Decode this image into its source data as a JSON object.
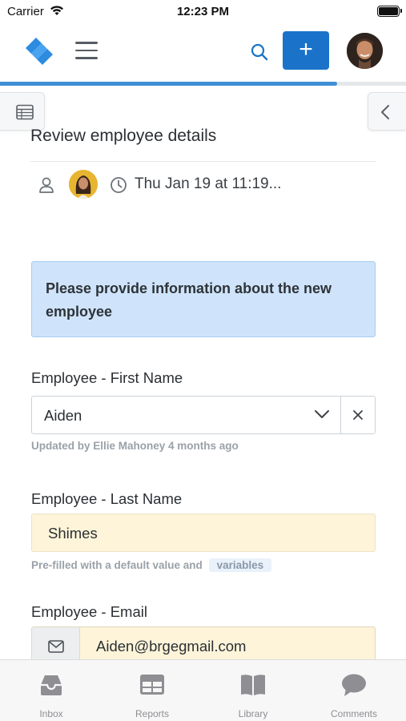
{
  "status_bar": {
    "carrier": "Carrier",
    "time": "12:23 PM"
  },
  "header": {
    "add_label": "+",
    "progress_fraction": 0.83,
    "colors": {
      "accent": "#1a73c8",
      "progress": "#3f8fd6",
      "logo": "#2d8be0"
    }
  },
  "page": {
    "title": "Review employee details",
    "meta_date": "Thu Jan 19 at 11:19..."
  },
  "info_box": {
    "text": "Please provide information about the new employee"
  },
  "fields": {
    "first_name": {
      "label": "Employee - First Name",
      "value": "Aiden",
      "helper": "Updated by Ellie Mahoney 4 months ago"
    },
    "last_name": {
      "label": "Employee - Last Name",
      "value": "Shimes",
      "helper": "Pre-filled with a default value and",
      "helper_pill": "variables"
    },
    "email": {
      "label": "Employee - Email",
      "value": "Aiden@brgegmail.com"
    }
  },
  "tabs": [
    {
      "label": "Inbox",
      "icon": "inbox-icon"
    },
    {
      "label": "Reports",
      "icon": "reports-icon"
    },
    {
      "label": "Library",
      "icon": "library-icon"
    },
    {
      "label": "Comments",
      "icon": "comments-icon"
    }
  ]
}
